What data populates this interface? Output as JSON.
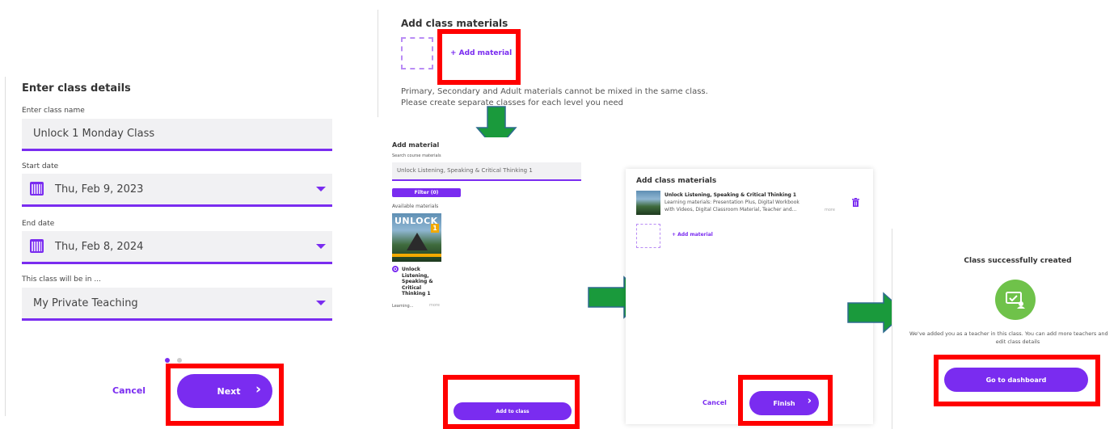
{
  "step1": {
    "title": "Enter class details",
    "class_name_label": "Enter class name",
    "class_name_value": "Unlock 1 Monday Class",
    "start_date_label": "Start date",
    "start_date_value": "Thu, Feb 9, 2023",
    "end_date_label": "End date",
    "end_date_value": "Thu, Feb 8, 2024",
    "location_label": "This class will be in ...",
    "location_value": "My Private Teaching",
    "cancel_label": "Cancel",
    "next_label": "Next",
    "next_chevron": "›"
  },
  "step2": {
    "title": "Add class materials",
    "add_material_label": "+ Add material",
    "note_line1": "Primary, Secondary and Adult materials cannot be mixed in the same class.",
    "note_line2": "Please create separate classes for each level you need"
  },
  "step3": {
    "title": "Add material",
    "search_label": "Search course materials",
    "search_value": "Unlock Listening, Speaking & Critical Thinking 1",
    "filter_label": "Filter (0)",
    "available_label": "Available materials",
    "book_cover_text": "UNLOCK",
    "book_cover_number": "1",
    "book_title": "Unlock Listening, Speaking & Critical Thinking 1",
    "book_meta": "Learning...",
    "more_label": "more",
    "add_to_class_label": "Add to class"
  },
  "step4": {
    "title": "Add class materials",
    "material_title": "Unlock Listening, Speaking & Critical Thinking 1",
    "material_desc_line1": "Learning materials: Presentation Plus, Digital Workbook",
    "material_desc_line2": "with Videos, Digital Classroom Material, Teacher and...",
    "more_label": "more",
    "add_material_label": "+ Add material",
    "cancel_label": "Cancel",
    "finish_label": "Finish",
    "finish_chevron": "›"
  },
  "step5": {
    "title": "Class successfully created",
    "message_line1": "We've added you as a teacher in this class. You can add more teachers and",
    "message_line2": "edit class details",
    "dashboard_label": "Go to dashboard"
  },
  "colors": {
    "accent": "#7a2cf0",
    "highlight": "#ff0000",
    "arrow": "#1a9a3c",
    "success": "#6fc24a"
  }
}
